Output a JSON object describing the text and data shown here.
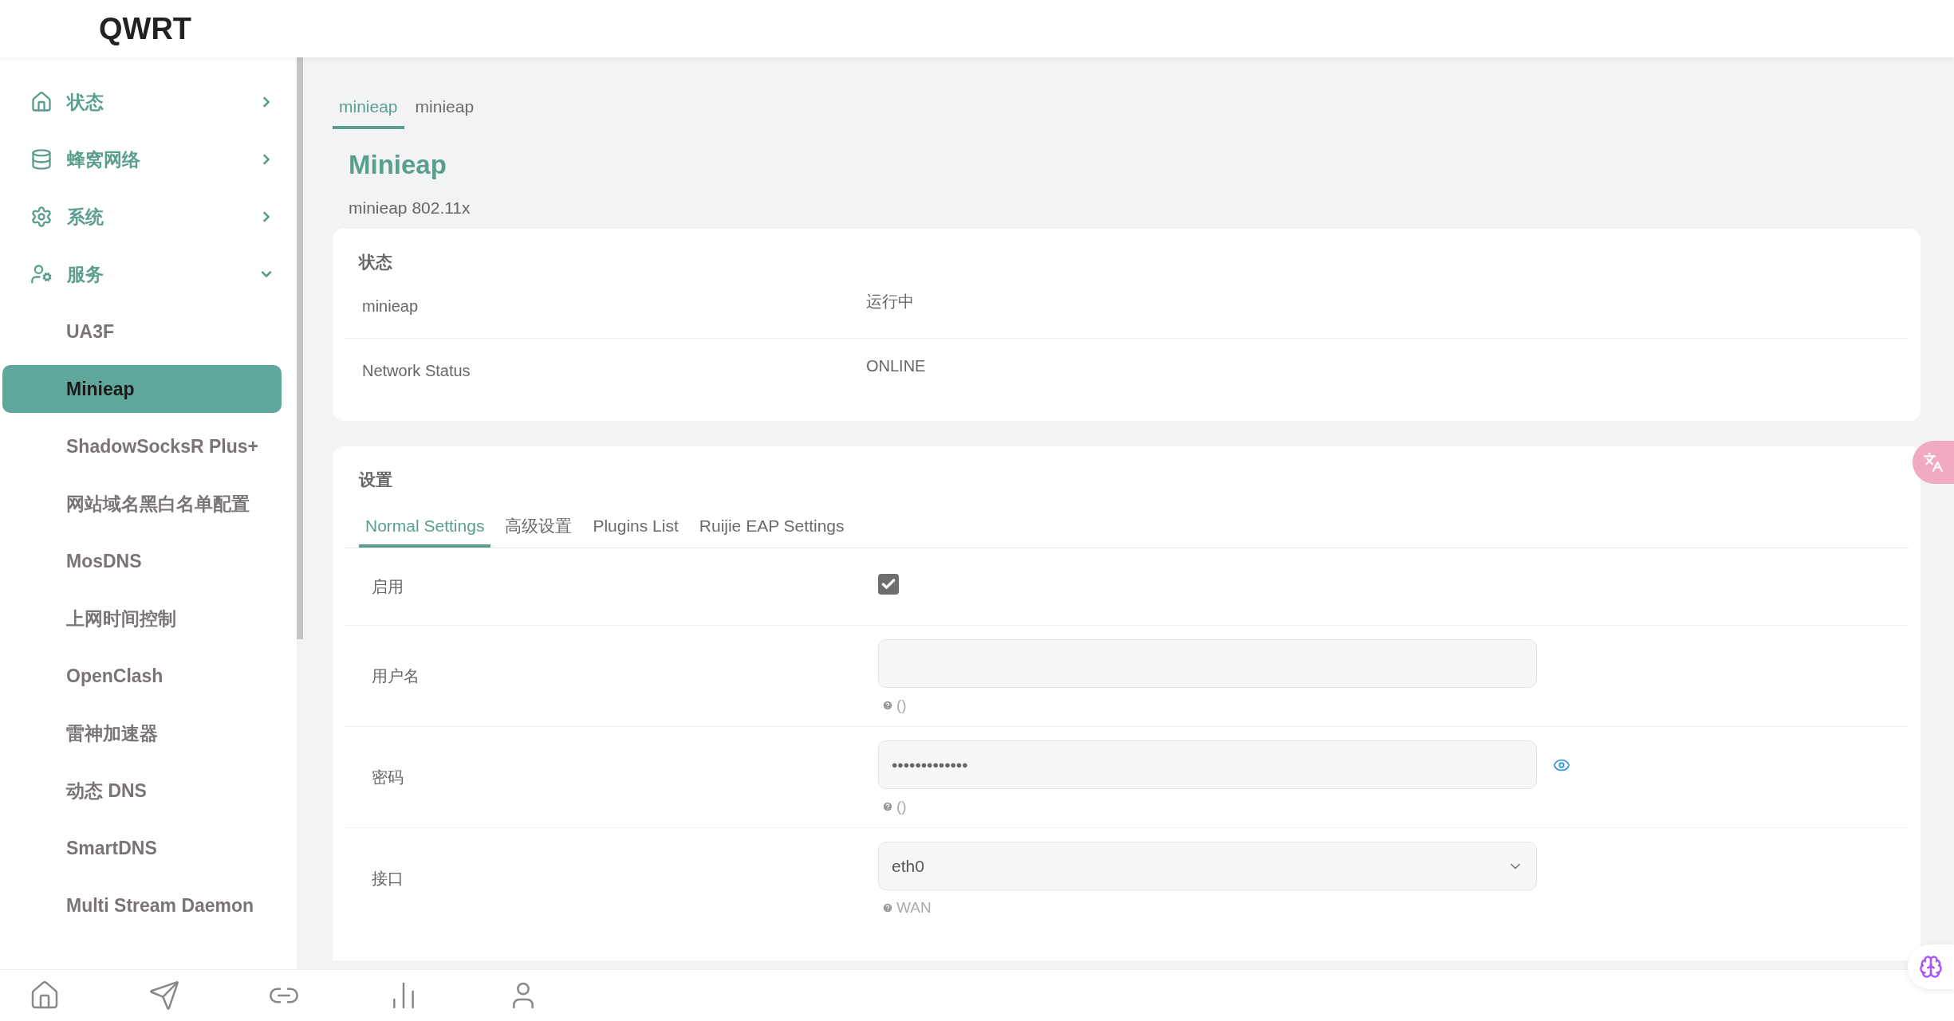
{
  "logo": "QWRT",
  "sidebar": {
    "items": [
      {
        "label": "状态",
        "expanded": false
      },
      {
        "label": "蜂窝网络",
        "expanded": false
      },
      {
        "label": "系统",
        "expanded": false
      },
      {
        "label": "服务",
        "expanded": true,
        "children": [
          {
            "label": "UA3F",
            "selected": false
          },
          {
            "label": "Minieap",
            "selected": true
          },
          {
            "label": "ShadowSocksR Plus+",
            "selected": false
          },
          {
            "label": "网站域名黑白名单配置",
            "selected": false
          },
          {
            "label": "MosDNS",
            "selected": false
          },
          {
            "label": "上网时间控制",
            "selected": false
          },
          {
            "label": "OpenClash",
            "selected": false
          },
          {
            "label": "雷神加速器",
            "selected": false
          },
          {
            "label": "动态 DNS",
            "selected": false
          },
          {
            "label": "SmartDNS",
            "selected": false
          },
          {
            "label": "Multi Stream Daemon",
            "selected": false
          }
        ]
      }
    ]
  },
  "page": {
    "tabs": [
      {
        "label": "minieap",
        "selected": true
      },
      {
        "label": "minieap",
        "selected": false
      }
    ],
    "title": "Minieap",
    "description": "minieap 802.11x"
  },
  "status_section": {
    "title": "状态",
    "rows": [
      {
        "label": "minieap",
        "value": "运行中"
      },
      {
        "label": "Network Status",
        "value": "ONLINE"
      }
    ]
  },
  "settings_section": {
    "title": "设置",
    "tabs": [
      {
        "label": "Normal Settings",
        "selected": true
      },
      {
        "label": "高级设置",
        "selected": false
      },
      {
        "label": "Plugins List",
        "selected": false
      },
      {
        "label": "Ruijie EAP Settings",
        "selected": false
      }
    ],
    "fields": [
      {
        "kind": "checkbox",
        "label": "启用",
        "checked": true
      },
      {
        "kind": "text",
        "label": "用户名",
        "help": "()"
      },
      {
        "kind": "password",
        "label": "密码",
        "value": "•••••••••••••",
        "help": "()"
      },
      {
        "kind": "select",
        "label": "接口",
        "value": "eth0",
        "help": "WAN"
      }
    ]
  }
}
